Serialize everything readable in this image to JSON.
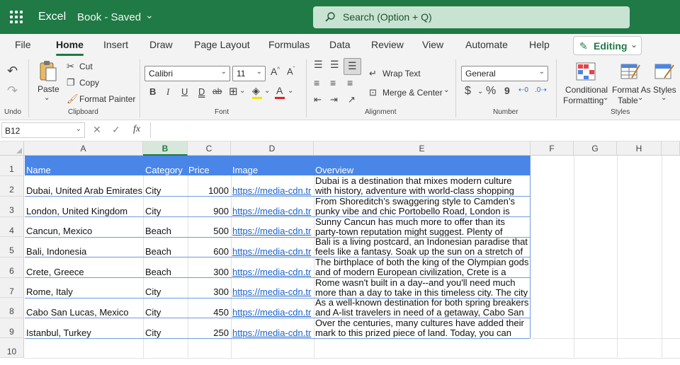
{
  "titlebar": {
    "app": "Excel",
    "document": "Book - Saved",
    "search_placeholder": "Search (Option + Q)"
  },
  "tabs": [
    "File",
    "Home",
    "Insert",
    "Draw",
    "Page Layout",
    "Formulas",
    "Data",
    "Review",
    "View",
    "Automate",
    "Help"
  ],
  "active_tab": "Home",
  "mode_button": "Editing",
  "ribbon": {
    "undo": {
      "label": "Undo"
    },
    "clipboard": {
      "label": "Clipboard",
      "paste": "Paste",
      "cut": "Cut",
      "copy": "Copy",
      "format_painter": "Format Painter"
    },
    "font": {
      "label": "Font",
      "name": "Calibri",
      "size": "11",
      "bold": "B",
      "italic": "I",
      "underline": "U",
      "double_underline": "D",
      "strike": "ab"
    },
    "alignment": {
      "label": "Alignment",
      "wrap": "Wrap Text",
      "merge": "Merge & Center"
    },
    "number": {
      "label": "Number",
      "format": "General",
      "currency": "$",
      "percent": "%",
      "comma": "9"
    },
    "styles": {
      "label": "Styles",
      "conditional": "Conditional",
      "conditional2": "Formatting",
      "format_as": "Format As",
      "format_as2": "Table",
      "styles": "Styles"
    }
  },
  "formula_bar": {
    "name_box": "B12",
    "fx": "fx",
    "formula": ""
  },
  "columns": [
    "A",
    "B",
    "C",
    "D",
    "E",
    "F",
    "G",
    "H"
  ],
  "selected_column": "B",
  "rows": [
    "1",
    "2",
    "3",
    "4",
    "5",
    "6",
    "7",
    "8",
    "9",
    "10"
  ],
  "table": {
    "headers": [
      "Name",
      "Category",
      "Price",
      "Image",
      "Overview"
    ],
    "rows": [
      {
        "name": "Dubai, United Arab Emirates",
        "category": "City",
        "price": "1000",
        "image": "https://media-cdn.tr",
        "overview": "Dubai is a destination that mixes modern culture with history, adventure with world-class shopping and"
      },
      {
        "name": "London, United Kingdom",
        "category": "City",
        "price": "900",
        "image": "https://media-cdn.tr",
        "overview": "From Shoreditch’s swaggering style to Camden’s punky vibe and chic Portobello Road, London is"
      },
      {
        "name": "Cancun, Mexico",
        "category": "Beach",
        "price": "500",
        "image": "https://media-cdn.tr",
        "overview": "Sunny Cancun has much more to offer than its party-town reputation might suggest. Plenty of"
      },
      {
        "name": "Bali, Indonesia",
        "category": "Beach",
        "price": "600",
        "image": "https://media-cdn.tr",
        "overview": "Bali is a living postcard, an Indonesian paradise that feels like a fantasy. Soak up the sun on a stretch of"
      },
      {
        "name": "Crete, Greece",
        "category": "Beach",
        "price": "300",
        "image": "https://media-cdn.tr",
        "overview": "The birthplace of both the king of the Olympian gods and of modern European civilization, Crete is a"
      },
      {
        "name": "Rome, Italy",
        "category": "City",
        "price": "300",
        "image": "https://media-cdn.tr",
        "overview": "Rome wasn't built in a day--and you'll need much more than a day to take in this timeless city. The city"
      },
      {
        "name": "Cabo San Lucas, Mexico",
        "category": "City",
        "price": "450",
        "image": "https://media-cdn.tr",
        "overview": "As a well-known destination for both spring breakers and A-list travelers in need of a getaway, Cabo San"
      },
      {
        "name": "Istanbul, Turkey",
        "category": "City",
        "price": "250",
        "image": "https://media-cdn.tr",
        "overview": "Over the centuries, many cultures have added their mark to this prized piece of land. Today, you can"
      }
    ]
  },
  "colors": {
    "brand": "#1f7a45",
    "header_band": "#4a86e8",
    "link": "#1a62c9"
  }
}
